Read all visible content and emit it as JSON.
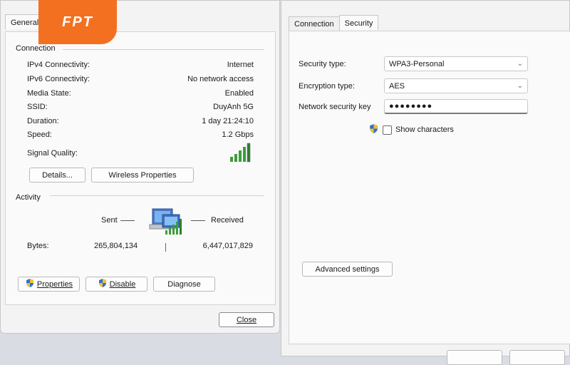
{
  "logo": {
    "text": "FPT",
    "color": "#f37021"
  },
  "status_dialog": {
    "tabs": [
      {
        "label": "General"
      }
    ],
    "connection": {
      "title": "Connection",
      "rows": [
        {
          "label": "IPv4 Connectivity:",
          "value": "Internet"
        },
        {
          "label": "IPv6 Connectivity:",
          "value": "No network access"
        },
        {
          "label": "Media State:",
          "value": "Enabled"
        },
        {
          "label": "SSID:",
          "value": "DuyAnh 5G"
        },
        {
          "label": "Duration:",
          "value": "1 day 21:24:10"
        },
        {
          "label": "Speed:",
          "value": "1.2 Gbps"
        }
      ],
      "signal_label": "Signal Quality:",
      "signal_icon": "signal-bars-icon",
      "details_button": "Details...",
      "wireless_properties_button": "Wireless Properties"
    },
    "activity": {
      "title": "Activity",
      "sent_label": "Sent",
      "received_label": "Received",
      "bytes_label": "Bytes:",
      "sent_bytes": "265,804,134",
      "received_bytes": "6,447,017,829",
      "network_icon": "network-computers-icon"
    },
    "buttons": {
      "properties": "Properties",
      "disable": "Disable",
      "diagnose": "Diagnose",
      "close": "Close"
    }
  },
  "properties_dialog": {
    "tabs": [
      {
        "label": "Connection"
      },
      {
        "label": "Security"
      }
    ],
    "security_type": {
      "label": "Security type:",
      "value": "WPA3-Personal"
    },
    "encryption_type": {
      "label": "Encryption type:",
      "value": "AES"
    },
    "network_key": {
      "label": "Network security key",
      "value": "●●●●●●●●"
    },
    "show_characters": {
      "label": "Show characters",
      "checked": false
    },
    "advanced_button": "Advanced settings"
  }
}
